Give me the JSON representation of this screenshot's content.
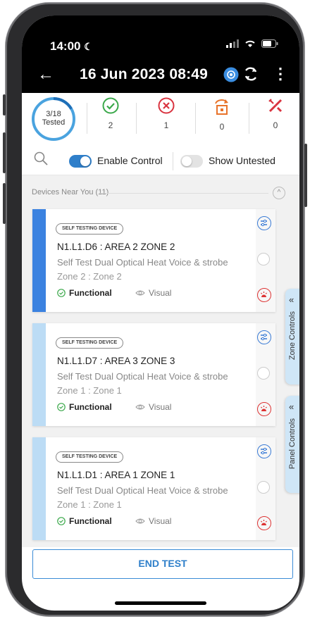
{
  "status_bar": {
    "time": "14:00"
  },
  "app_bar": {
    "title": "16 Jun 2023 08:49"
  },
  "summary": {
    "progress_line1": "3/18",
    "progress_line2": "Tested",
    "progress_fraction": 0.1667,
    "passed_count": "2",
    "failed_count": "1",
    "skipped_count": "0",
    "faulty_count": "0"
  },
  "filters": {
    "enable_control_label": "Enable Control",
    "enable_control_on": true,
    "show_untested_label": "Show Untested",
    "show_untested_on": false
  },
  "section": {
    "header": "Devices Near You (11)"
  },
  "devices": [
    {
      "badge": "SELF TESTING DEVICE",
      "title": "N1.L1.D6 : AREA 2 ZONE 2",
      "type": "Self Test Dual Optical Heat Voice & strobe",
      "zone": "Zone 2 : Zone 2",
      "status": "Functional",
      "visual": "Visual"
    },
    {
      "badge": "SELF TESTING DEVICE",
      "title": "N1.L1.D7 : AREA 3  ZONE 3",
      "type": "Self Test Dual Optical Heat Voice & strobe",
      "zone": "Zone 1 : Zone 1",
      "status": "Functional",
      "visual": "Visual"
    },
    {
      "badge": "SELF TESTING DEVICE",
      "title": "N1.L1.D1 : AREA 1 ZONE 1",
      "type": "Self Test Dual Optical Heat Voice & strobe",
      "zone": "Zone 1 : Zone 1",
      "status": "Functional",
      "visual": "Visual"
    }
  ],
  "side_tabs": {
    "zone_controls": "Zone Controls",
    "panel_controls": "Panel Controls"
  },
  "end_test_label": "END TEST",
  "colors": {
    "accent_blue": "#2f7fca",
    "active_stripe": "#3b82e0",
    "inactive_stripe": "#bcdcf5",
    "pass_green": "#3aa84a",
    "fail_red": "#d9333f",
    "skip_orange": "#e8732a"
  },
  "icons": [
    "back-arrow-icon",
    "camera-icon",
    "sync-icon",
    "more-vert-icon",
    "check-circle-icon",
    "x-circle-icon",
    "skip-icon",
    "wrench-icon",
    "search-icon",
    "settings-sliders-icon",
    "alarm-icon",
    "eye-icon"
  ]
}
